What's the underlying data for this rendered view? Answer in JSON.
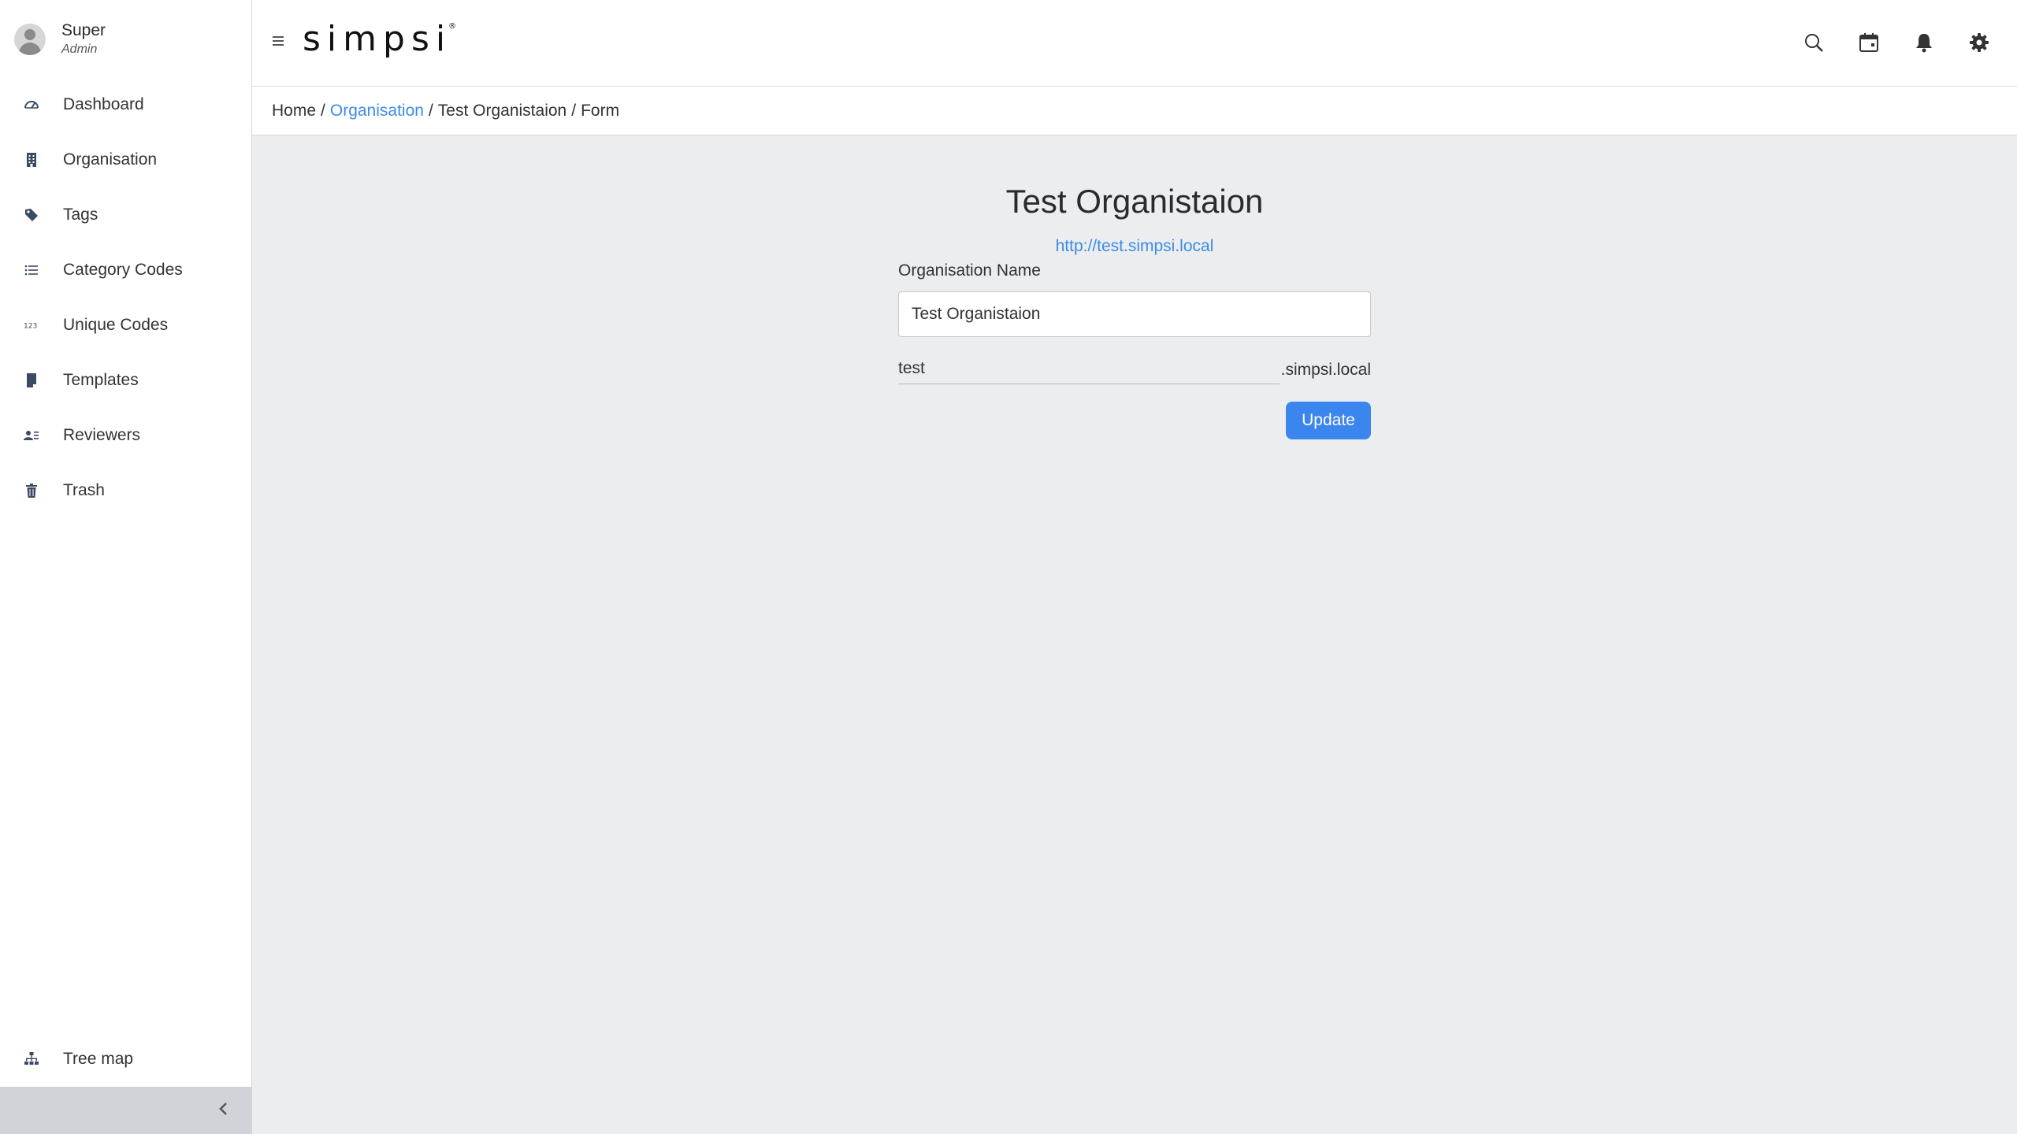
{
  "user": {
    "name": "Super",
    "role": "Admin"
  },
  "nav": [
    {
      "label": "Dashboard",
      "icon": "speedometer-icon"
    },
    {
      "label": "Organisation",
      "icon": "building-icon"
    },
    {
      "label": "Tags",
      "icon": "tags-icon"
    },
    {
      "label": "Category Codes",
      "icon": "list-icon"
    },
    {
      "label": "Unique Codes",
      "icon": "numbers-123-icon"
    },
    {
      "label": "Templates",
      "icon": "file-icon"
    },
    {
      "label": "Reviewers",
      "icon": "person-lines-icon"
    },
    {
      "label": "Trash",
      "icon": "trash-icon"
    }
  ],
  "tree_map": {
    "label": "Tree map",
    "icon": "sitemap-icon"
  },
  "header": {
    "logo_text": "simpsi",
    "logo_mark": "®",
    "icons": [
      "search-icon",
      "calendar-icon",
      "bell-icon",
      "gear-icon"
    ]
  },
  "breadcrumb": {
    "home": "Home",
    "organisation": "Organisation",
    "current": "Test Organistaion",
    "page": "Form",
    "separator": "/"
  },
  "form": {
    "title": "Test Organistaion",
    "url": "http://test.simpsi.local",
    "name_label": "Organisation Name",
    "name_value": "Test Organistaion",
    "subdomain_value": "test",
    "subdomain_suffix": ".simpsi.local",
    "update_label": "Update"
  },
  "colors": {
    "accent": "#3b86ee",
    "link": "#3c8ce7",
    "background": "#ebedef",
    "sidebar_footer": "#d1d3d8"
  }
}
